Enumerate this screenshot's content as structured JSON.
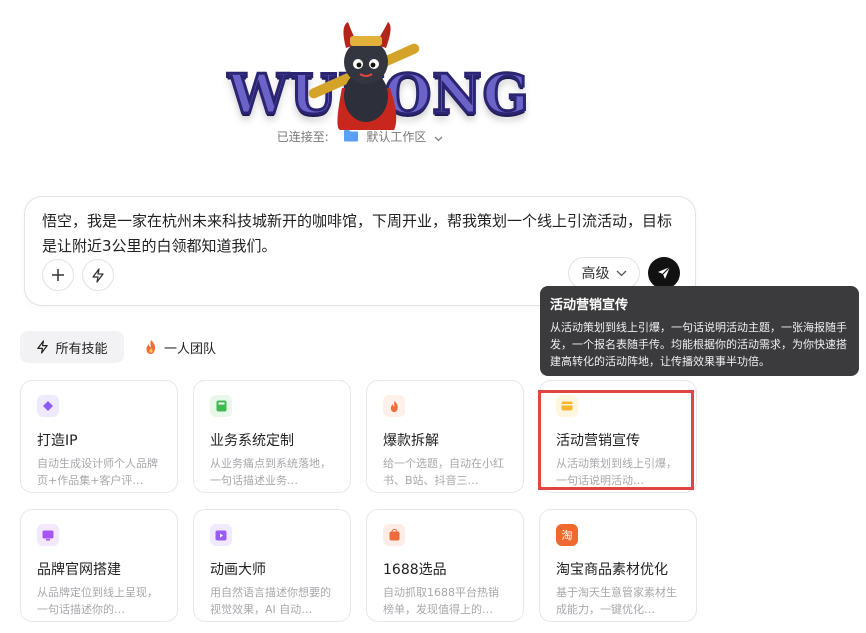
{
  "header": {
    "logo_text": "WUKONG",
    "connected_label": "已连接至:",
    "workspace": "默认工作区"
  },
  "input": {
    "prompt_text": "悟空，我是一家在杭州未来科技城新开的咖啡馆，下周开业，帮我策划一个线上引流活动，目标是让附近3公里的白领都知道我们。",
    "advanced_label": "高级"
  },
  "tooltip": {
    "title": "活动营销宣传",
    "description": "从活动策划到线上引爆，一句话说明活动主题，一张海报随手发，一个报名表随手传。均能根据你的活动需求，为你快速搭建高转化的活动阵地，让传播效果事半功倍。"
  },
  "tabs": [
    {
      "label": "所有技能",
      "icon": "lightning-icon"
    },
    {
      "label": "一人团队",
      "icon": "fire-icon"
    }
  ],
  "cards": [
    {
      "title": "打造IP",
      "desc": "自动生成设计师个人品牌页+作品集+客户评…",
      "icon": "ip-icon",
      "color": "#8b5cf6",
      "bg": "#efe9ff"
    },
    {
      "title": "业务系统定制",
      "desc": "从业务痛点到系统落地，一句话描述业务…",
      "icon": "calculator-icon",
      "color": "#3fb950",
      "bg": "#e7f7ea"
    },
    {
      "title": "爆款拆解",
      "desc": "给一个选题，自动在小红书、B站、抖音三…",
      "icon": "flame-icon",
      "color": "#f26b3a",
      "bg": "#fff0e9"
    },
    {
      "title": "活动营销宣传",
      "desc": "从活动策划到线上引爆，一句话说明活动…",
      "icon": "card-icon",
      "color": "#f5b72c",
      "bg": "#fff6df"
    },
    {
      "title": "品牌官网搭建",
      "desc": "从品牌定位到线上呈现，一句话描述你的…",
      "icon": "monitor-icon",
      "color": "#a855f7",
      "bg": "#f3e8ff"
    },
    {
      "title": "动画大师",
      "desc": "用自然语言描述你想要的视觉效果，AI 自动…",
      "icon": "video-icon",
      "color": "#9b5cf6",
      "bg": "#f1eaff"
    },
    {
      "title": "1688选品",
      "desc": "自动抓取1688平台热销榜单，发现值得上的…",
      "icon": "shop-icon",
      "color": "#f26b3a",
      "bg": "#ffece6"
    },
    {
      "title": "淘宝商品素材优化",
      "desc": "基于淘天生意管家素材生成能力，一键优化…",
      "icon": "taobao-icon",
      "color": "#f06a2d",
      "bg": "#ffeee6",
      "glyph": "淘"
    }
  ]
}
